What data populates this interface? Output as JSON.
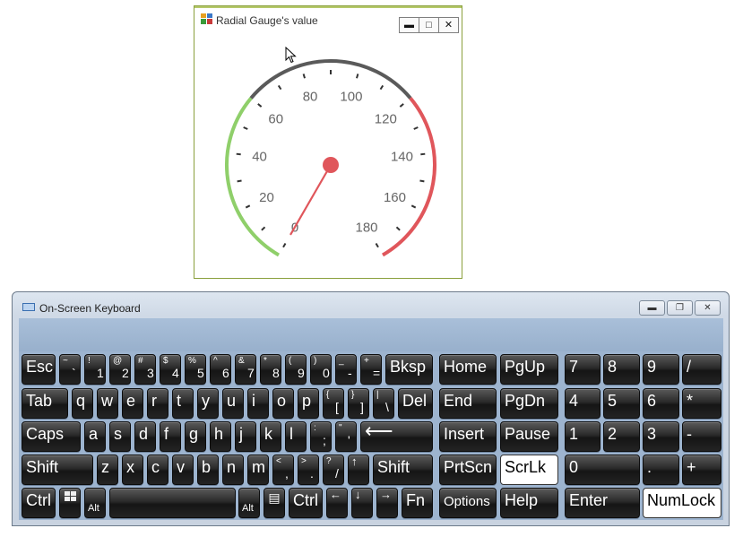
{
  "gauge_window": {
    "title": "Radial Gauge's value",
    "icon": "app-icon",
    "controls": [
      "minimize-icon",
      "maximize-icon",
      "close-icon"
    ],
    "gauge": {
      "value": 0,
      "min": 0,
      "max": 180,
      "major_ticks": [
        "0",
        "20",
        "40",
        "60",
        "80",
        "100",
        "120",
        "140",
        "160",
        "180"
      ],
      "range_colors": {
        "low": "#8fcf6a",
        "mid": "#5a5a5a",
        "high": "#e0565b"
      },
      "needle_color": "#e0565b"
    }
  },
  "osk": {
    "title": "On-Screen Keyboard",
    "icon": "keyboard-icon",
    "controls": [
      "minimize-icon",
      "restore-icon",
      "close-icon"
    ],
    "keys": {
      "esc": "Esc",
      "tilde_up": "~",
      "tilde_dn": "`",
      "n1_up": "!",
      "n1": "1",
      "n2_up": "@",
      "n2": "2",
      "n3_up": "#",
      "n3": "3",
      "n4_up": "$",
      "n4": "4",
      "n5_up": "%",
      "n5": "5",
      "n6_up": "^",
      "n6": "6",
      "n7_up": "&",
      "n7": "7",
      "n8_up": "*",
      "n8": "8",
      "n9_up": "(",
      "n9": "9",
      "n0_up": ")",
      "n0": "0",
      "minus_up": "_",
      "minus": "-",
      "equals_up": "+",
      "equals": "=",
      "bksp": "Bksp",
      "home": "Home",
      "pgup": "PgUp",
      "np7": "7",
      "np8": "8",
      "np9": "9",
      "npslash": "/",
      "tab": "Tab",
      "q": "q",
      "w": "w",
      "e": "e",
      "r": "r",
      "t": "t",
      "y": "y",
      "u": "u",
      "i": "i",
      "o": "o",
      "p": "p",
      "lbr_up": "{",
      "lbr": "[",
      "rbr_up": "}",
      "rbr": "]",
      "bsl_up": "|",
      "bsl": "\\",
      "del": "Del",
      "end": "End",
      "pgdn": "PgDn",
      "np4": "4",
      "np5": "5",
      "np6": "6",
      "npstar": "*",
      "caps": "Caps",
      "a": "a",
      "s": "s",
      "d": "d",
      "f": "f",
      "g": "g",
      "h": "h",
      "j": "j",
      "k": "k",
      "l": "l",
      "semi_up": ":",
      "semi": ";",
      "quote_up": "\"",
      "quote": "'",
      "enter_arrow": "⟵",
      "insert": "Insert",
      "pause": "Pause",
      "np1": "1",
      "np2": "2",
      "np3": "3",
      "npminus": "-",
      "shift_l": "Shift",
      "z": "z",
      "x": "x",
      "c": "c",
      "v": "v",
      "b": "b",
      "n": "n",
      "m": "m",
      "comma_up": "<",
      "comma": ",",
      "period_up": ">",
      "period": ".",
      "slash_up": "?",
      "slash": "/",
      "up": "↑",
      "shift_r": "Shift",
      "prtscn": "PrtScn",
      "scrlk": "ScrLk",
      "np0": "0",
      "npdot": ".",
      "npplus": "+",
      "ctrl_l": "Ctrl",
      "alt_l": "Alt",
      "alt_r": "Alt",
      "ctrl_r": "Ctrl",
      "left": "←",
      "down": "↓",
      "right": "→",
      "fn": "Fn",
      "options": "Options",
      "help": "Help",
      "npenter": "Enter",
      "numlock": "NumLock"
    }
  }
}
